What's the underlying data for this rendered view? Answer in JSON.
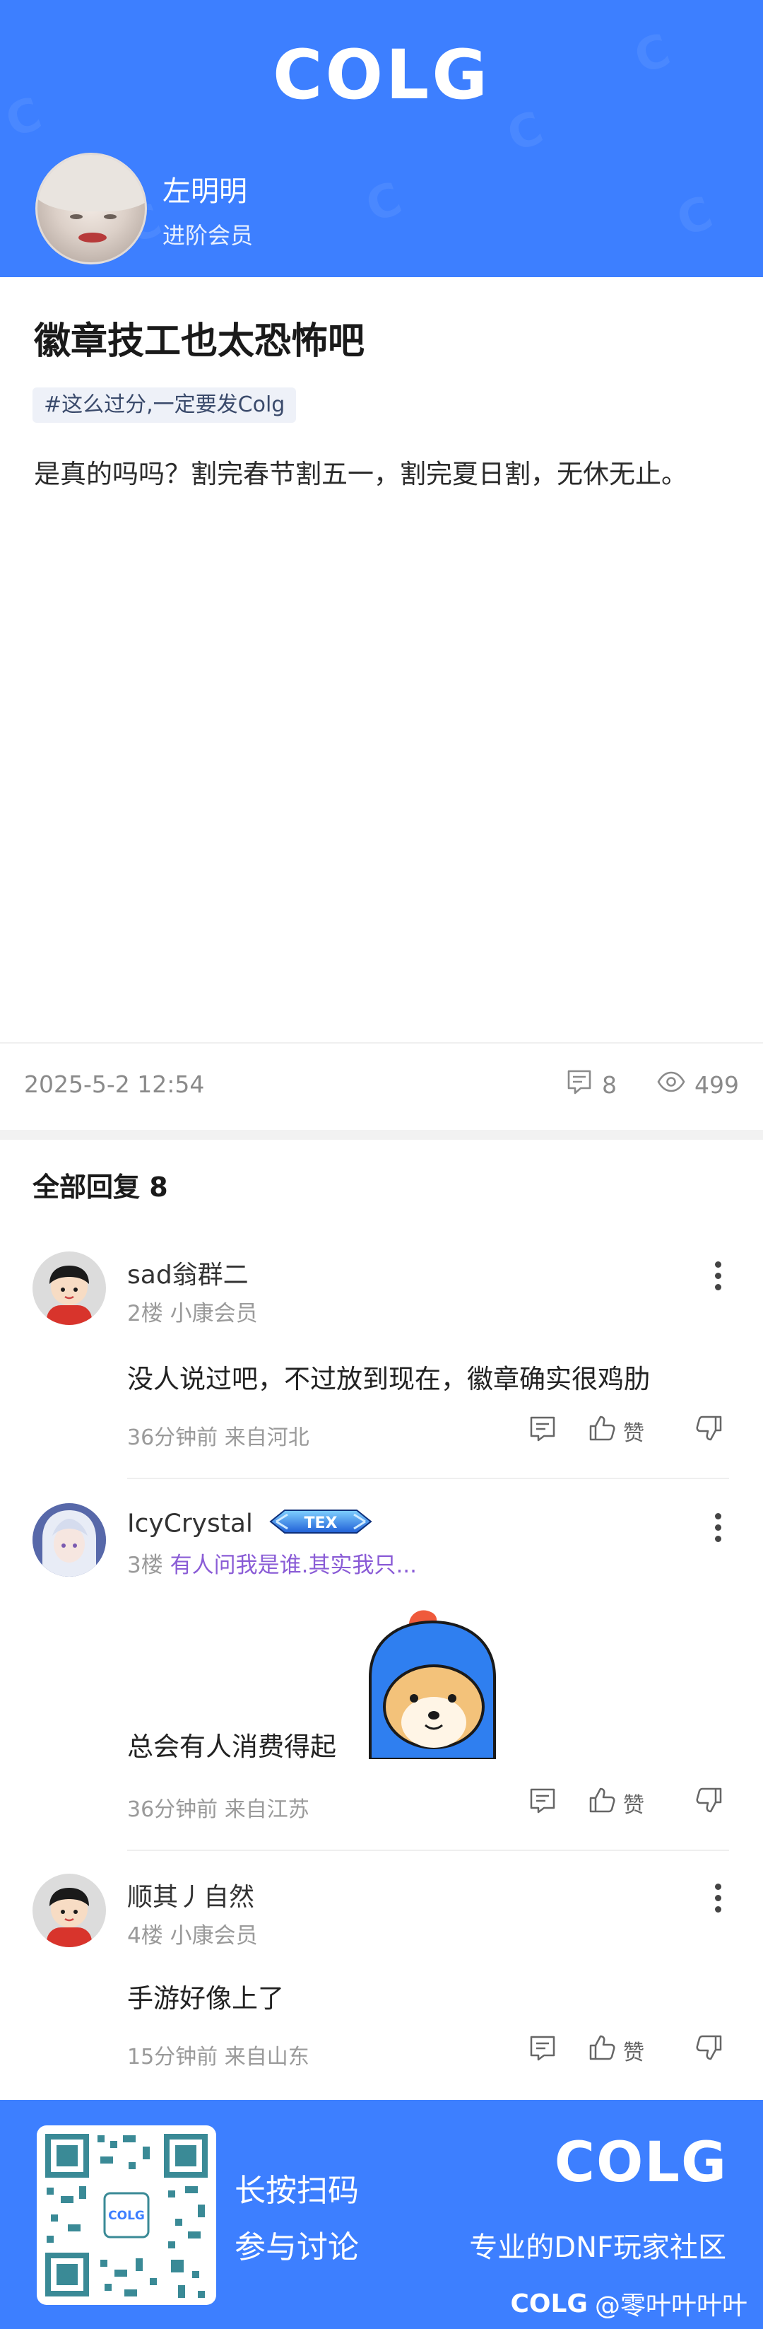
{
  "header": {
    "logo": "COLG",
    "author_name": "左明明",
    "author_level": "进阶会员"
  },
  "post": {
    "title": "徽章技工也太恐怖吧",
    "tag": "#这么过分,一定要发Colg",
    "body": "是真的吗吗？割完春节割五一，割完夏日割，无休无止。",
    "datetime": "2025-5-2 12:54",
    "comment_count": "8",
    "view_count": "499"
  },
  "replies": {
    "header": "全部回复  8",
    "items": [
      {
        "name": "sad翁群二",
        "floor": "2楼",
        "level": "小康会员",
        "text": "没人说过吧，不过放到现在，徽章确实很鸡肋",
        "time": "36分钟前",
        "location": "来自河北",
        "like_label": "赞"
      },
      {
        "name": "IcyCrystal",
        "floor": "3楼",
        "level": "有人问我是谁.其实我只...",
        "badge": "TEX",
        "text": "总会有人消费得起",
        "time": "36分钟前",
        "location": "来自江苏",
        "like_label": "赞"
      },
      {
        "name": "顺其丿自然",
        "floor": "4楼",
        "level": "小康会员",
        "text": "手游好像上了",
        "time": "15分钟前",
        "location": "来自山东",
        "like_label": "赞"
      }
    ]
  },
  "footer": {
    "cta_line1": "长按扫码",
    "cta_line2": "参与讨论",
    "logo": "COLG",
    "slogan": "专业的DNF玩家社区",
    "credit_logo": "COLG",
    "credit_user": "@零叶叶叶叶"
  },
  "colors": {
    "brand_blue": "#3d7fff",
    "signature_purple": "#8a5cd6"
  }
}
